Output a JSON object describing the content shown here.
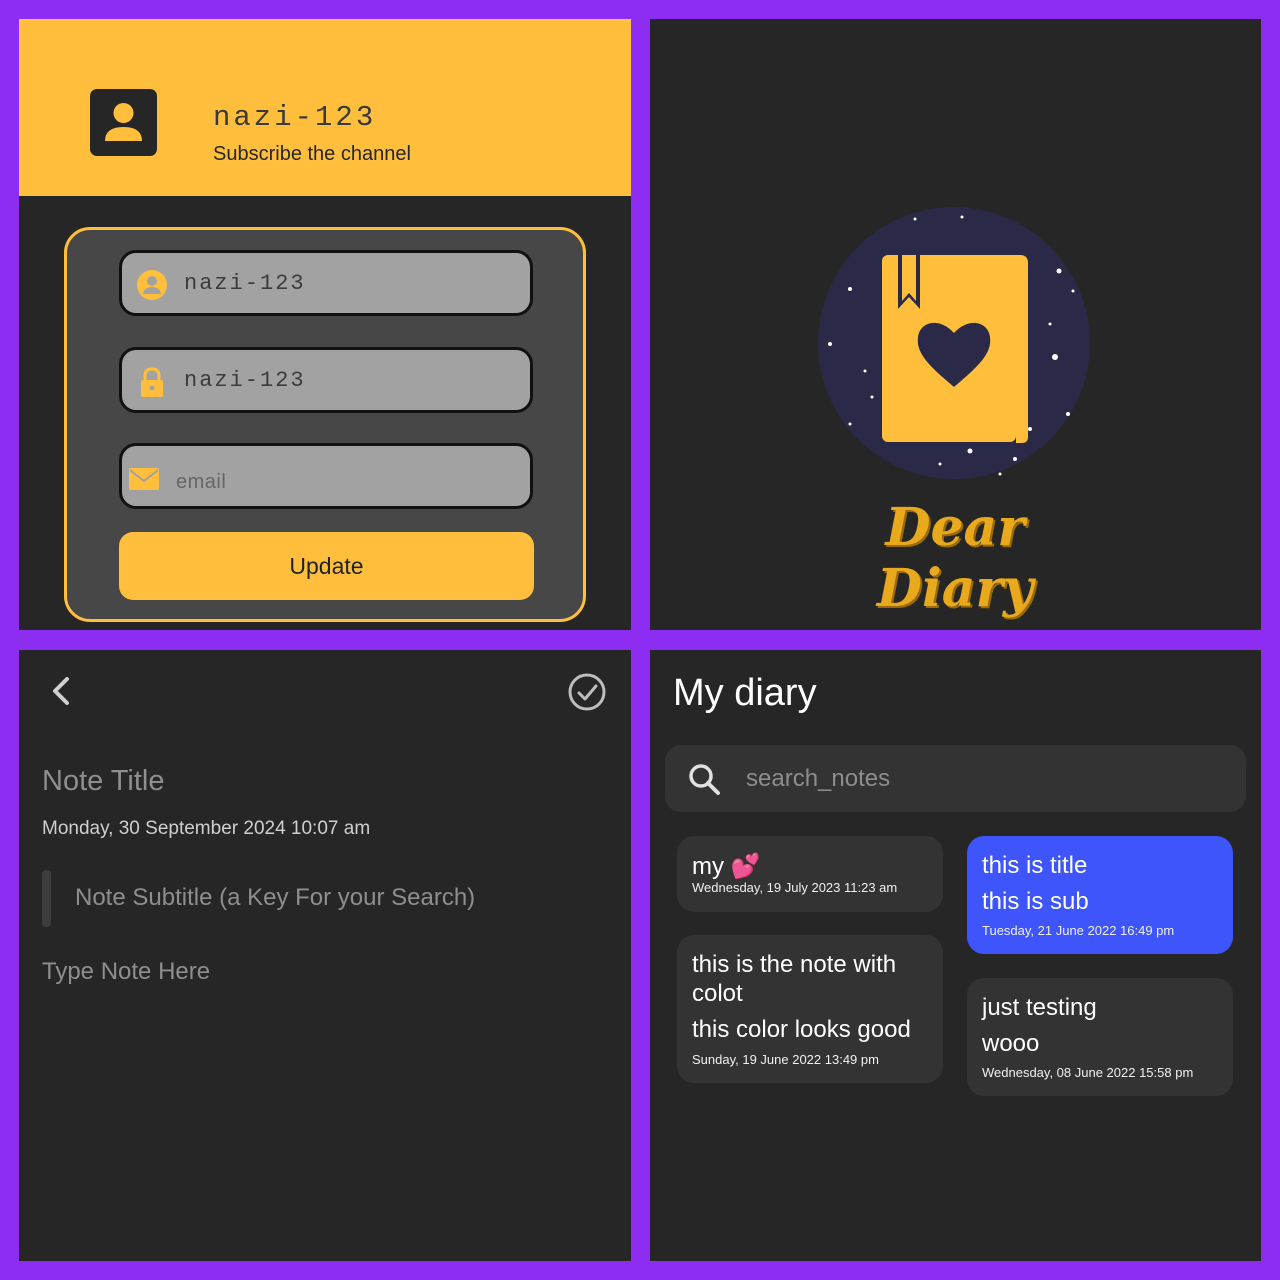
{
  "profile": {
    "username": "nazi-123",
    "subtitle": "Subscribe the channel",
    "username_field": "nazi-123",
    "password_field": "nazi-123",
    "email_placeholder": "email",
    "update_label": "Update",
    "accent": "#ffbf3c"
  },
  "splash": {
    "app_name": "Dear Diary"
  },
  "editor": {
    "title_placeholder": "Note Title",
    "date": "Monday, 30 September 2024 10:07 am",
    "subtitle_placeholder": "Note Subtitle (a Key For your Search)",
    "body_placeholder": "Type Note Here"
  },
  "diary": {
    "title": "My diary",
    "search_placeholder": "search_notes",
    "notes": [
      {
        "title": "my 💕",
        "subtitle": "",
        "date": "Wednesday, 19 July 2023 11:23 am",
        "color": "#333333"
      },
      {
        "title": "this is title",
        "subtitle": "this is sub",
        "date": "Tuesday, 21 June 2022 16:49 pm",
        "color": "#3d55fb"
      },
      {
        "title": "this is the note with colot",
        "subtitle": "this color looks good",
        "date": "Sunday, 19 June 2022 13:49 pm",
        "color": "#333333"
      },
      {
        "title": "just testing",
        "subtitle": "wooo",
        "date": "Wednesday, 08 June 2022 15:58 pm",
        "color": "#333333"
      }
    ]
  }
}
